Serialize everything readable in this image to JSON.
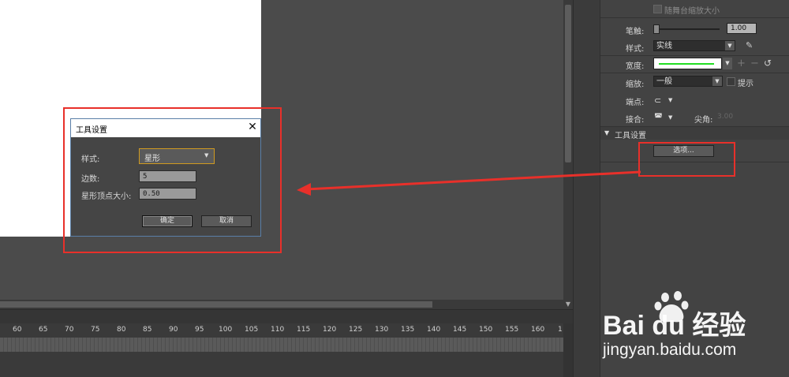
{
  "properties_panel": {
    "scale_with_stage_label": "随舞台缩放大小",
    "stroke_label": "笔触:",
    "stroke_value": "1.00",
    "style_label": "样式:",
    "style_value": "实线",
    "width_label": "宽度:",
    "scale_label": "缩放:",
    "scale_value": "一般",
    "hint_label": "提示",
    "cap_label": "端点:",
    "join_label": "接合:",
    "miter_label": "尖角:",
    "miter_value": "3.00",
    "tool_settings_section": "工具设置",
    "options_button": "选项..."
  },
  "dialog": {
    "title": "工具设置",
    "style_label": "样式:",
    "style_value": "星形",
    "sides_label": "边数:",
    "sides_value": "5",
    "star_point_label": "星形顶点大小:",
    "star_point_value": "0.50",
    "ok_button": "确定",
    "cancel_button": "取消"
  },
  "timeline": {
    "ruler_ticks": [
      "60",
      "65",
      "70",
      "75",
      "80",
      "85",
      "90",
      "95",
      "100",
      "105",
      "110",
      "115",
      "120",
      "125",
      "130",
      "135",
      "140",
      "145",
      "150",
      "155",
      "160",
      "1"
    ]
  },
  "watermark": {
    "brand": "Bai du 经验",
    "url": "jingyan.baidu.com"
  },
  "colors": {
    "annotation_red": "#e8302a",
    "stroke_swatch": "#22dd22",
    "dialog_border": "#5a7fa8"
  }
}
